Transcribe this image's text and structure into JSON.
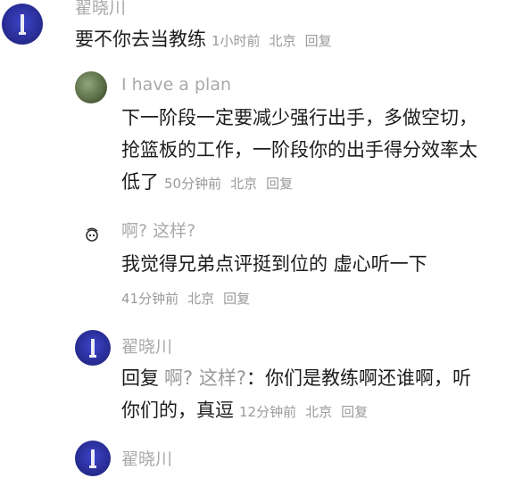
{
  "comments": [
    {
      "username": "翟晓川",
      "text": "要不你去当教练",
      "time": "1小时前",
      "location": "北京",
      "reply_label": "回复"
    },
    {
      "username": "I have a plan",
      "text_lines": [
        "下一阶段一定要减少强行出手，多做空切，",
        "抢篮板的工作，一阶段你的出手得分效率太",
        "低了"
      ],
      "time": "50分钟前",
      "location": "北京",
      "reply_label": "回复"
    },
    {
      "username": "啊? 这样?",
      "text": "我觉得兄弟点评挺到位的 虚心听一下",
      "time": "41分钟前",
      "location": "北京",
      "reply_label": "回复"
    },
    {
      "username": "翟晓川",
      "reply_prefix": "回复",
      "reply_to": "啊? 这样?",
      "text_line1": "：你们是教练啊还谁啊，听",
      "text_line2": "你们的，真逗",
      "time": "12分钟前",
      "location": "北京",
      "reply_label": "回复"
    },
    {
      "username": "翟晓川"
    }
  ],
  "colors": {
    "username": "#a9a9a9",
    "meta": "#9a9a9a",
    "text": "#1c1c1c"
  }
}
